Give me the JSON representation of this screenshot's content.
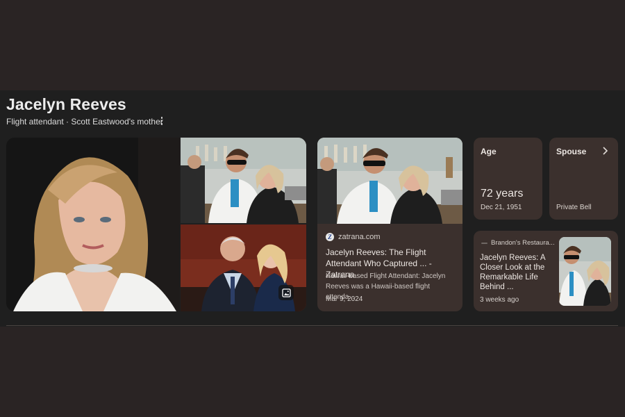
{
  "knowledge_panel": {
    "title": "Jacelyn Reeves",
    "subtitle": "Flight attendant · Scott Eastwood's mother"
  },
  "news": {
    "source": "zatrana.com",
    "title": "Jacelyn Reeves: The Flight Attendant Who Captured ... - Zatrana",
    "snippet": "Hawaii-based Flight Attendant: Jacelyn Reeves was a Hawaii-based flight attenda...",
    "date": "Mar 9, 2024"
  },
  "facts": {
    "age_label": "Age",
    "age_value": "72 years",
    "age_dob": "Dec 21, 1951",
    "spouse_label": "Spouse",
    "spouse_value": "Private Bell"
  },
  "related": {
    "source": "Brandon's Restaura...",
    "title": "Jacelyn Reeves: A Closer Look at the Remarkable Life Behind ...",
    "date": "3 weeks ago"
  },
  "colors": {
    "page_background": "#2a2424",
    "panel_background": "#1f1f1f",
    "card_background": "#3b302d"
  },
  "icons": [
    "more-vert-icon",
    "image-search-icon",
    "chevron-right-icon",
    "zatrana-logo-icon"
  ]
}
